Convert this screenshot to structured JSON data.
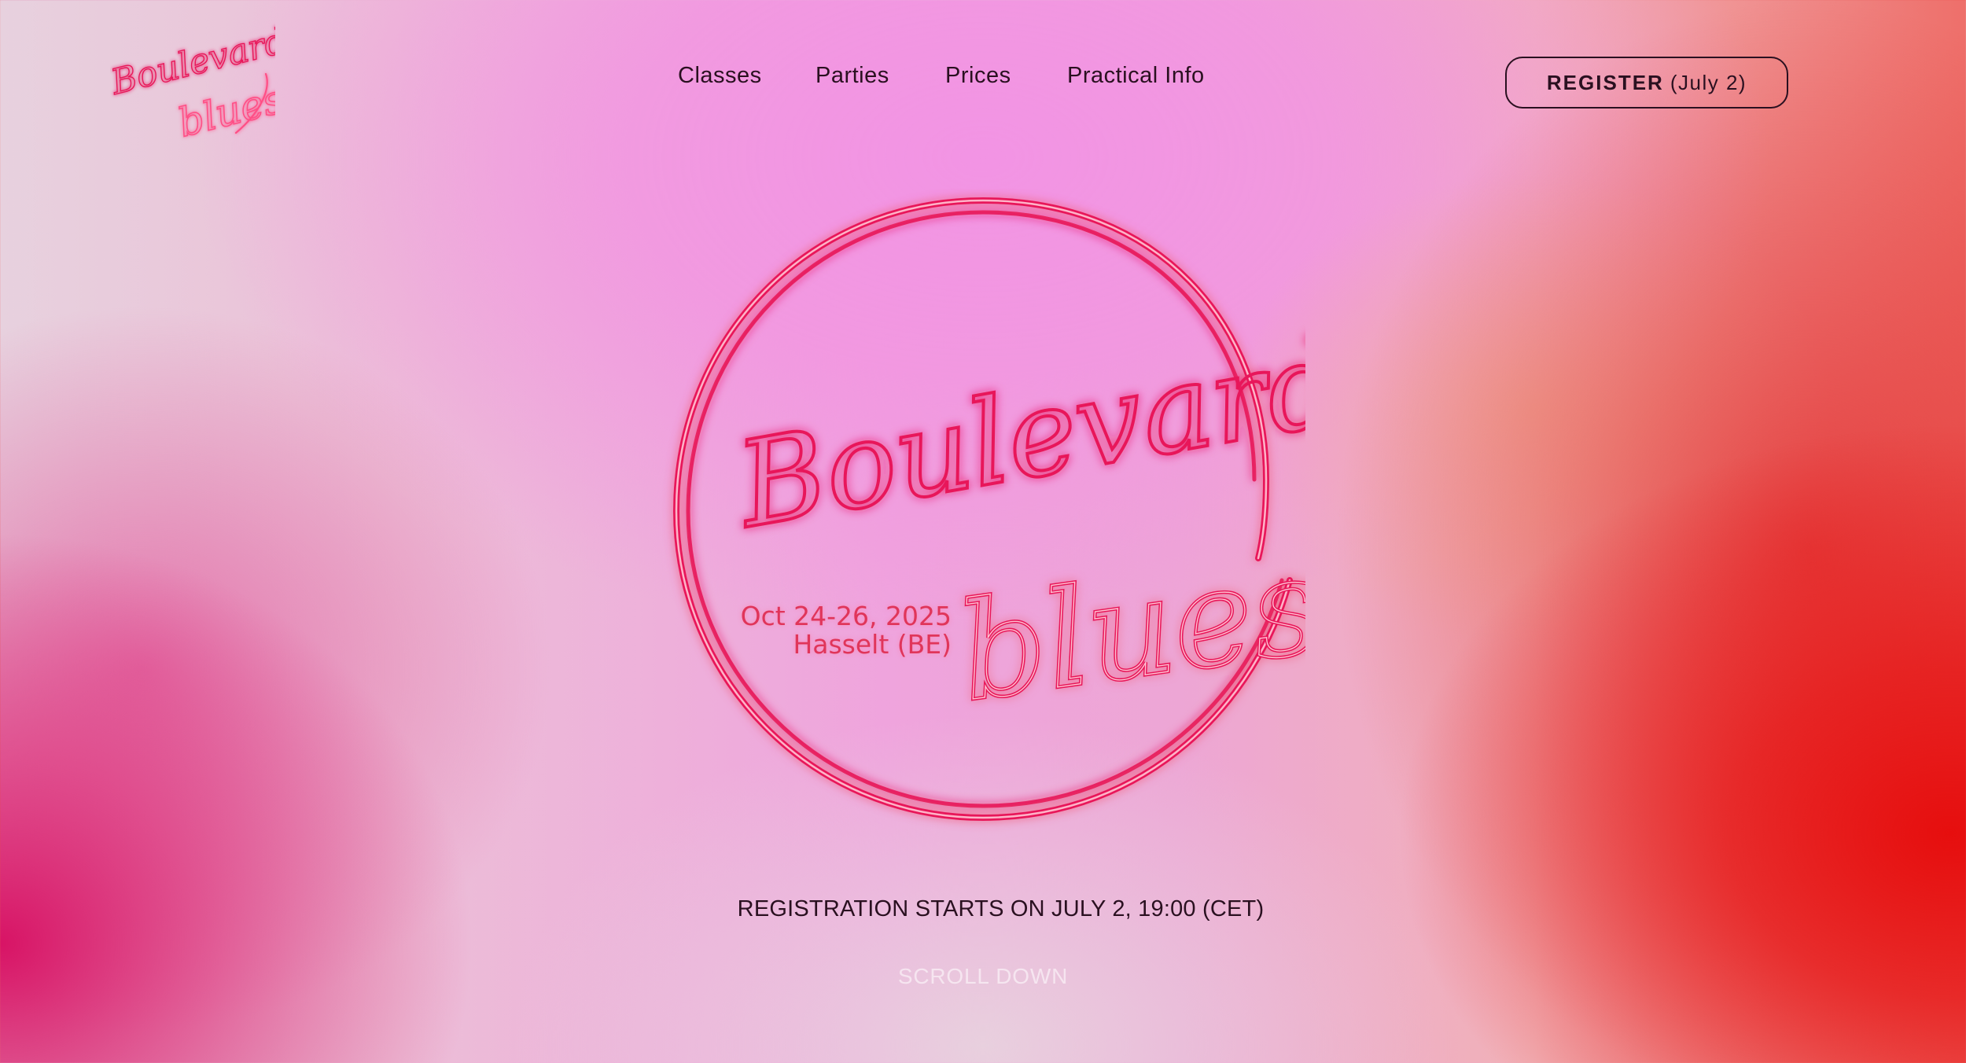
{
  "brand": {
    "logo_line1": "Boulevard",
    "logo_line2": "blues",
    "accent_color": "#e8195a",
    "glow_color": "#ff6f9a"
  },
  "nav": {
    "items": [
      {
        "label": "Classes"
      },
      {
        "label": "Parties"
      },
      {
        "label": "Prices"
      },
      {
        "label": "Practical Info"
      }
    ]
  },
  "register_button": {
    "label": "REGISTER",
    "date": "(July 2)"
  },
  "hero": {
    "title_line1": "Boulevard",
    "title_line2": "blues",
    "date_line": "Oct 24-26, 2025",
    "location_line": "Hasselt (BE)"
  },
  "registration_note": "REGISTRATION STARTS ON JULY 2, 19:00 (CET)",
  "scroll_label": "SCROLL DOWN"
}
